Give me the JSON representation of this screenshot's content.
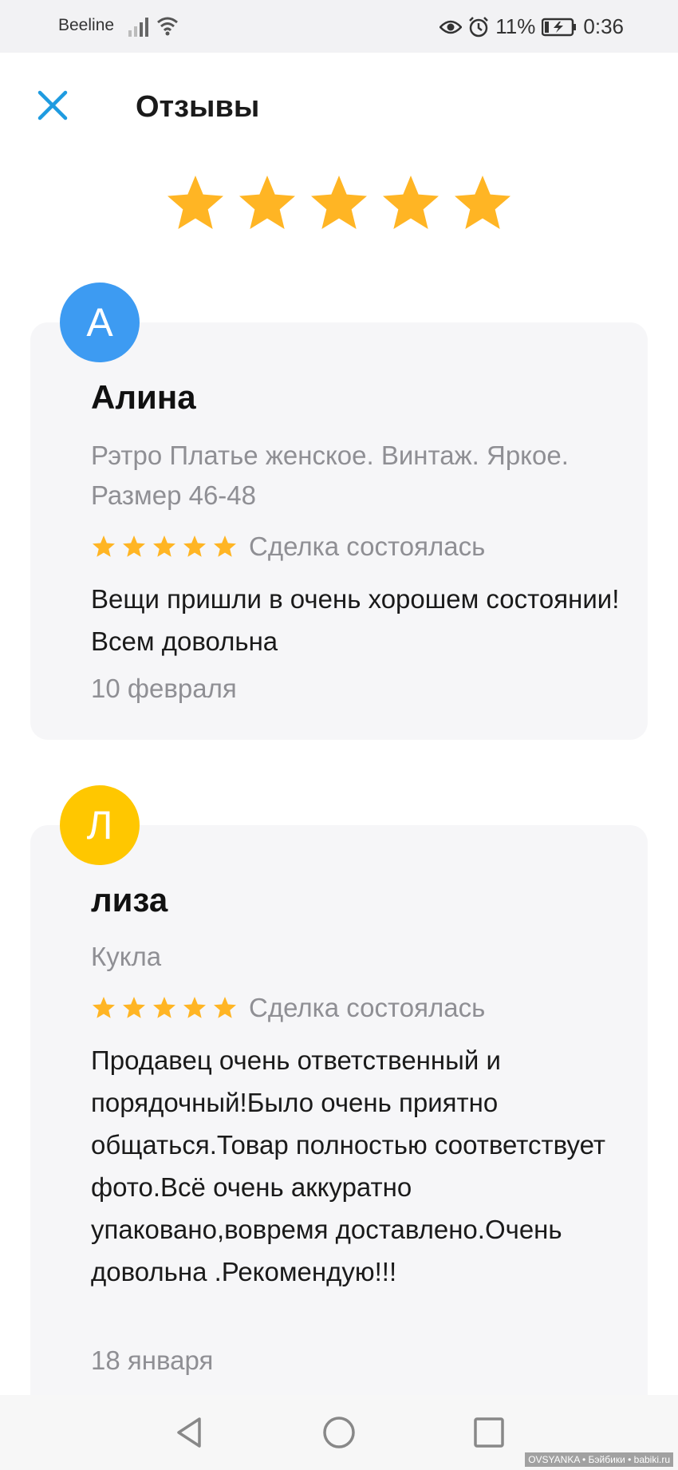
{
  "status_bar": {
    "carrier": "Beeline",
    "battery": "11%",
    "time": "0:36",
    "icons": [
      "signal-icon",
      "wifi-icon",
      "eye-icon",
      "alarm-icon",
      "battery-charging-icon"
    ]
  },
  "header": {
    "title": "Отзывы",
    "close_icon": "close-icon"
  },
  "overall_rating": {
    "stars": 5,
    "max": 5,
    "color": "#FFB524"
  },
  "reviews": [
    {
      "avatar_letter": "А",
      "avatar_color": "#3D9BF2",
      "name": "Алина",
      "product": "Рэтро Платье женское. Винтаж. Яркое. Размер 46-48",
      "rating": 5,
      "status": "Сделка состоялась",
      "text": "Вещи пришли в очень хорошем состоянии! Всем довольна",
      "date": "10 февраля"
    },
    {
      "avatar_letter": "Л",
      "avatar_color": "#FFC700",
      "name": "лиза",
      "product": "Кукла",
      "rating": 5,
      "status": "Сделка состоялась",
      "text": "Продавец очень ответственный и порядочный!Было очень приятно общаться.Товар полностью соответствует фото.Всё очень аккуратно упаковано,вовремя доставлено.Очень довольна .Рекомендую!!!",
      "date": "18 января"
    }
  ],
  "nav_bar": {
    "icons": [
      "back-icon",
      "home-icon",
      "recents-icon"
    ]
  },
  "watermark": "OVSYANKA • Бэйбики • babiki.ru"
}
